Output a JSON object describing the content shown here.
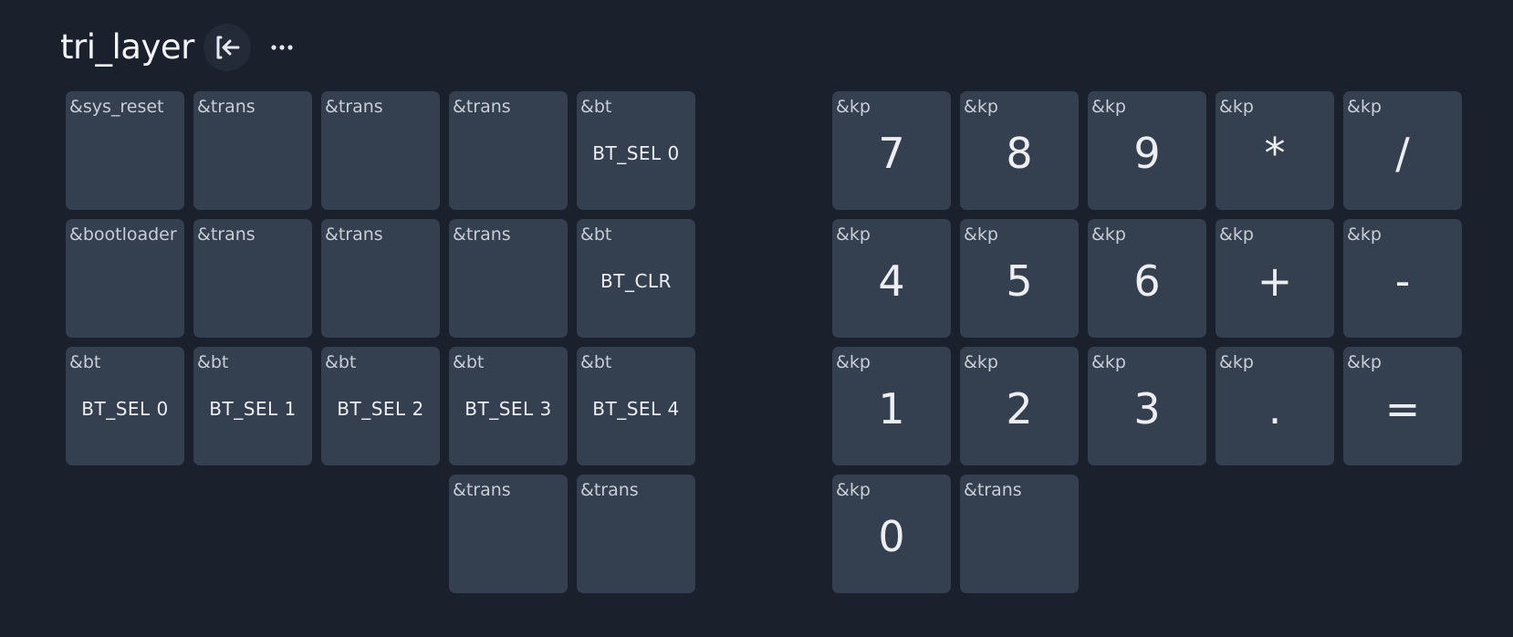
{
  "header": {
    "layer_name": "tri_layer",
    "back_icon": "exit-arrow-icon",
    "more_icon": "ellipsis-icon"
  },
  "colors": {
    "background": "#1a202c",
    "key": "#343f4f",
    "icon_button": "#232b38"
  },
  "left_half": [
    {
      "behavior": "&sys_reset",
      "param": ""
    },
    {
      "behavior": "&trans",
      "param": ""
    },
    {
      "behavior": "&trans",
      "param": ""
    },
    {
      "behavior": "&trans",
      "param": ""
    },
    {
      "behavior": "&bt",
      "param": "BT_SEL 0"
    },
    {
      "behavior": "&bootloader",
      "param": ""
    },
    {
      "behavior": "&trans",
      "param": ""
    },
    {
      "behavior": "&trans",
      "param": ""
    },
    {
      "behavior": "&trans",
      "param": ""
    },
    {
      "behavior": "&bt",
      "param": "BT_CLR"
    },
    {
      "behavior": "&bt",
      "param": "BT_SEL 0"
    },
    {
      "behavior": "&bt",
      "param": "BT_SEL 1"
    },
    {
      "behavior": "&bt",
      "param": "BT_SEL 2"
    },
    {
      "behavior": "&bt",
      "param": "BT_SEL 3"
    },
    {
      "behavior": "&bt",
      "param": "BT_SEL 4"
    },
    {
      "behavior": "&trans",
      "param": ""
    },
    {
      "behavior": "&trans",
      "param": ""
    }
  ],
  "right_half": [
    {
      "behavior": "&kp",
      "param": "7"
    },
    {
      "behavior": "&kp",
      "param": "8"
    },
    {
      "behavior": "&kp",
      "param": "9"
    },
    {
      "behavior": "&kp",
      "param": "*"
    },
    {
      "behavior": "&kp",
      "param": "/"
    },
    {
      "behavior": "&kp",
      "param": "4"
    },
    {
      "behavior": "&kp",
      "param": "5"
    },
    {
      "behavior": "&kp",
      "param": "6"
    },
    {
      "behavior": "&kp",
      "param": "+"
    },
    {
      "behavior": "&kp",
      "param": "-"
    },
    {
      "behavior": "&kp",
      "param": "1"
    },
    {
      "behavior": "&kp",
      "param": "2"
    },
    {
      "behavior": "&kp",
      "param": "3"
    },
    {
      "behavior": "&kp",
      "param": "."
    },
    {
      "behavior": "&kp",
      "param": "="
    },
    {
      "behavior": "&kp",
      "param": "0"
    },
    {
      "behavior": "&trans",
      "param": ""
    }
  ]
}
